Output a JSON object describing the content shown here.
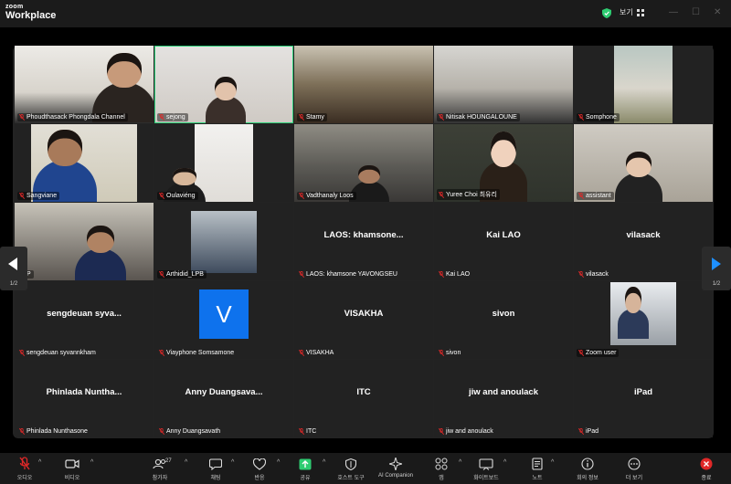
{
  "app": {
    "logo_top": "zoom",
    "logo_bottom": "Workplace"
  },
  "titlebar": {
    "view_label": "보기"
  },
  "colors": {
    "active_speaker": "#2fd17a",
    "mute": "#e02828",
    "share": "#2ecc71",
    "avatar_bg": "#0e72ed"
  },
  "pagination": {
    "left": "1/2",
    "right": "1/2"
  },
  "participants": [
    {
      "name": "Phoudthasack Phongdala Channel"
    },
    {
      "name": "sejong"
    },
    {
      "name": "Stamy"
    },
    {
      "name": "Nitisak HOUNGALOUNE"
    },
    {
      "name": "Somphone"
    },
    {
      "name": "Sangviane"
    },
    {
      "name": "Oulaviéng"
    },
    {
      "name": "Vadthanaly Loos"
    },
    {
      "name": "Yuree Choi 최유리"
    },
    {
      "name": "assistant"
    },
    {
      "name": "P"
    },
    {
      "name": "Arthidid_LPB"
    },
    {
      "name": "LAOS: khamsone YAVONGSEU",
      "display": "LAOS:  khamsone..."
    },
    {
      "name": "Kai LAO",
      "display": "Kai LAO"
    },
    {
      "name": "vilasack",
      "display": "vilasack"
    },
    {
      "name": "sengdeuan syvannkham",
      "display": "sengdeuan  syva..."
    },
    {
      "name": "Viayphone Somsamone",
      "avatar": "V"
    },
    {
      "name": "VISAKHA",
      "display": "VISAKHA"
    },
    {
      "name": "sivon",
      "display": "sivon"
    },
    {
      "name": "Zoom user"
    },
    {
      "name": "Phinlada Nunthasone",
      "display": "Phinlada  Nuntha..."
    },
    {
      "name": "Anny Duangsavath",
      "display": "Anny  Duangsava..."
    },
    {
      "name": "ITC",
      "display": "ITC"
    },
    {
      "name": "jiw and anoulack",
      "display": "jiw and anoulack"
    },
    {
      "name": "iPad",
      "display": "iPad"
    }
  ],
  "toolbar": {
    "audio": "오디오",
    "video": "비디오",
    "participants": "참가자",
    "participants_count": "27",
    "chat": "채팅",
    "react": "반응",
    "share": "공유",
    "host_tools": "호스트 도구",
    "ai": "AI Companion",
    "apps": "앱",
    "whiteboard": "화이트보드",
    "notes": "노트",
    "info": "회의 정보",
    "more": "더 보기",
    "end": "종료"
  }
}
